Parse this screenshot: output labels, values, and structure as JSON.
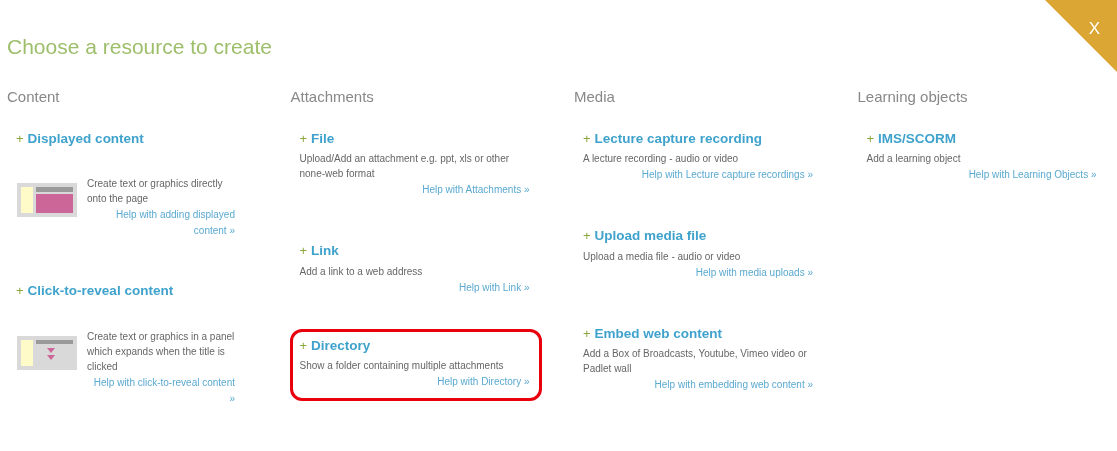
{
  "title": "Choose a resource to create",
  "close_button": {
    "label": "X"
  },
  "columns": [
    {
      "heading": "Content",
      "items": [
        {
          "kind": "panel",
          "plus": "+",
          "title": "Displayed content",
          "description": "Create text or graphics directly onto the page",
          "help": "Help with adding displayed content »",
          "highlighted": false
        },
        {
          "kind": "reveal",
          "plus": "+",
          "title": "Click-to-reveal content",
          "description": "Create text or graphics in a panel which expands when the title is clicked",
          "help": "Help with click-to-reveal content »",
          "highlighted": false
        }
      ]
    },
    {
      "heading": "Attachments",
      "items": [
        {
          "kind": "plain",
          "plus": "+",
          "title": "File",
          "description": "Upload/Add an attachment e.g. ppt, xls or other none-web format",
          "help": "Help with Attachments »",
          "highlighted": false
        },
        {
          "kind": "plain",
          "plus": "+",
          "title": "Link",
          "description": "Add a link to a web address",
          "help": "Help with Link »",
          "highlighted": false
        },
        {
          "kind": "plain",
          "plus": "+",
          "title": "Directory",
          "description": "Show a folder containing multiple attachments",
          "help": "Help with Directory »",
          "highlighted": true
        }
      ]
    },
    {
      "heading": "Media",
      "items": [
        {
          "kind": "plain",
          "plus": "+",
          "title": "Lecture capture recording",
          "description": "A lecture recording - audio or video",
          "help": "Help with Lecture capture recordings »",
          "highlighted": false
        },
        {
          "kind": "plain",
          "plus": "+",
          "title": "Upload media file",
          "description": "Upload a media file - audio or video",
          "help": "Help with media uploads »",
          "highlighted": false
        },
        {
          "kind": "plain",
          "plus": "+",
          "title": "Embed web content",
          "description": "Add a Box of Broadcasts, Youtube, Vimeo video or Padlet wall",
          "help": "Help with embedding web content »",
          "highlighted": false
        }
      ]
    },
    {
      "heading": "Learning objects",
      "items": [
        {
          "kind": "plain",
          "plus": "+",
          "title": "IMS/SCORM",
          "description": "Add a learning object",
          "help": "Help with Learning Objects »",
          "highlighted": false
        }
      ]
    }
  ]
}
